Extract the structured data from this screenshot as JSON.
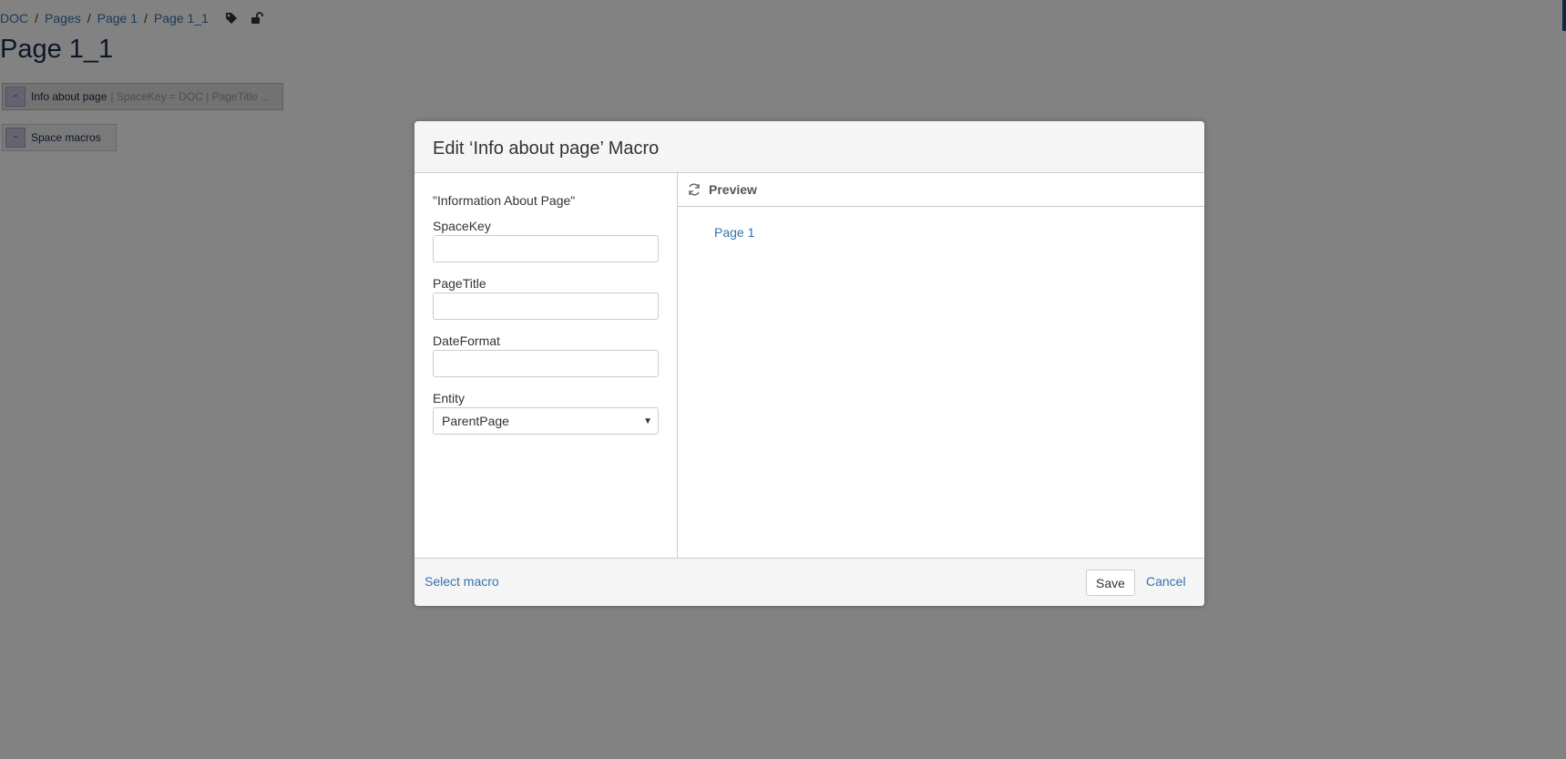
{
  "breadcrumbs": [
    "DOC",
    "Pages",
    "Page 1",
    "Page 1_1"
  ],
  "page": {
    "title": "Page 1_1",
    "macro_info": {
      "name": "Info about page",
      "params": "| SpaceKey = DOC | PageTitle ..."
    },
    "macro_space": {
      "name": "Space macros"
    }
  },
  "dialog": {
    "title": "Edit ‘Info about page’ Macro",
    "description": "\"Information About Page\"",
    "fields": {
      "space_key": {
        "label": "SpaceKey",
        "value": ""
      },
      "page_title": {
        "label": "PageTitle",
        "value": ""
      },
      "date_format": {
        "label": "DateFormat",
        "value": ""
      },
      "entity": {
        "label": "Entity",
        "value": "ParentPage"
      }
    },
    "preview": {
      "title": "Preview",
      "link": "Page 1"
    },
    "footer": {
      "select_macro": "Select macro",
      "save": "Save",
      "cancel": "Cancel"
    }
  },
  "colors": {
    "link": "#3572b0",
    "overlay": "rgba(0,0,0,0.49)",
    "header_bg": "#f5f5f5"
  },
  "icons": [
    "tag-icon",
    "unlock-icon",
    "refresh-icon",
    "macro-icon"
  ]
}
